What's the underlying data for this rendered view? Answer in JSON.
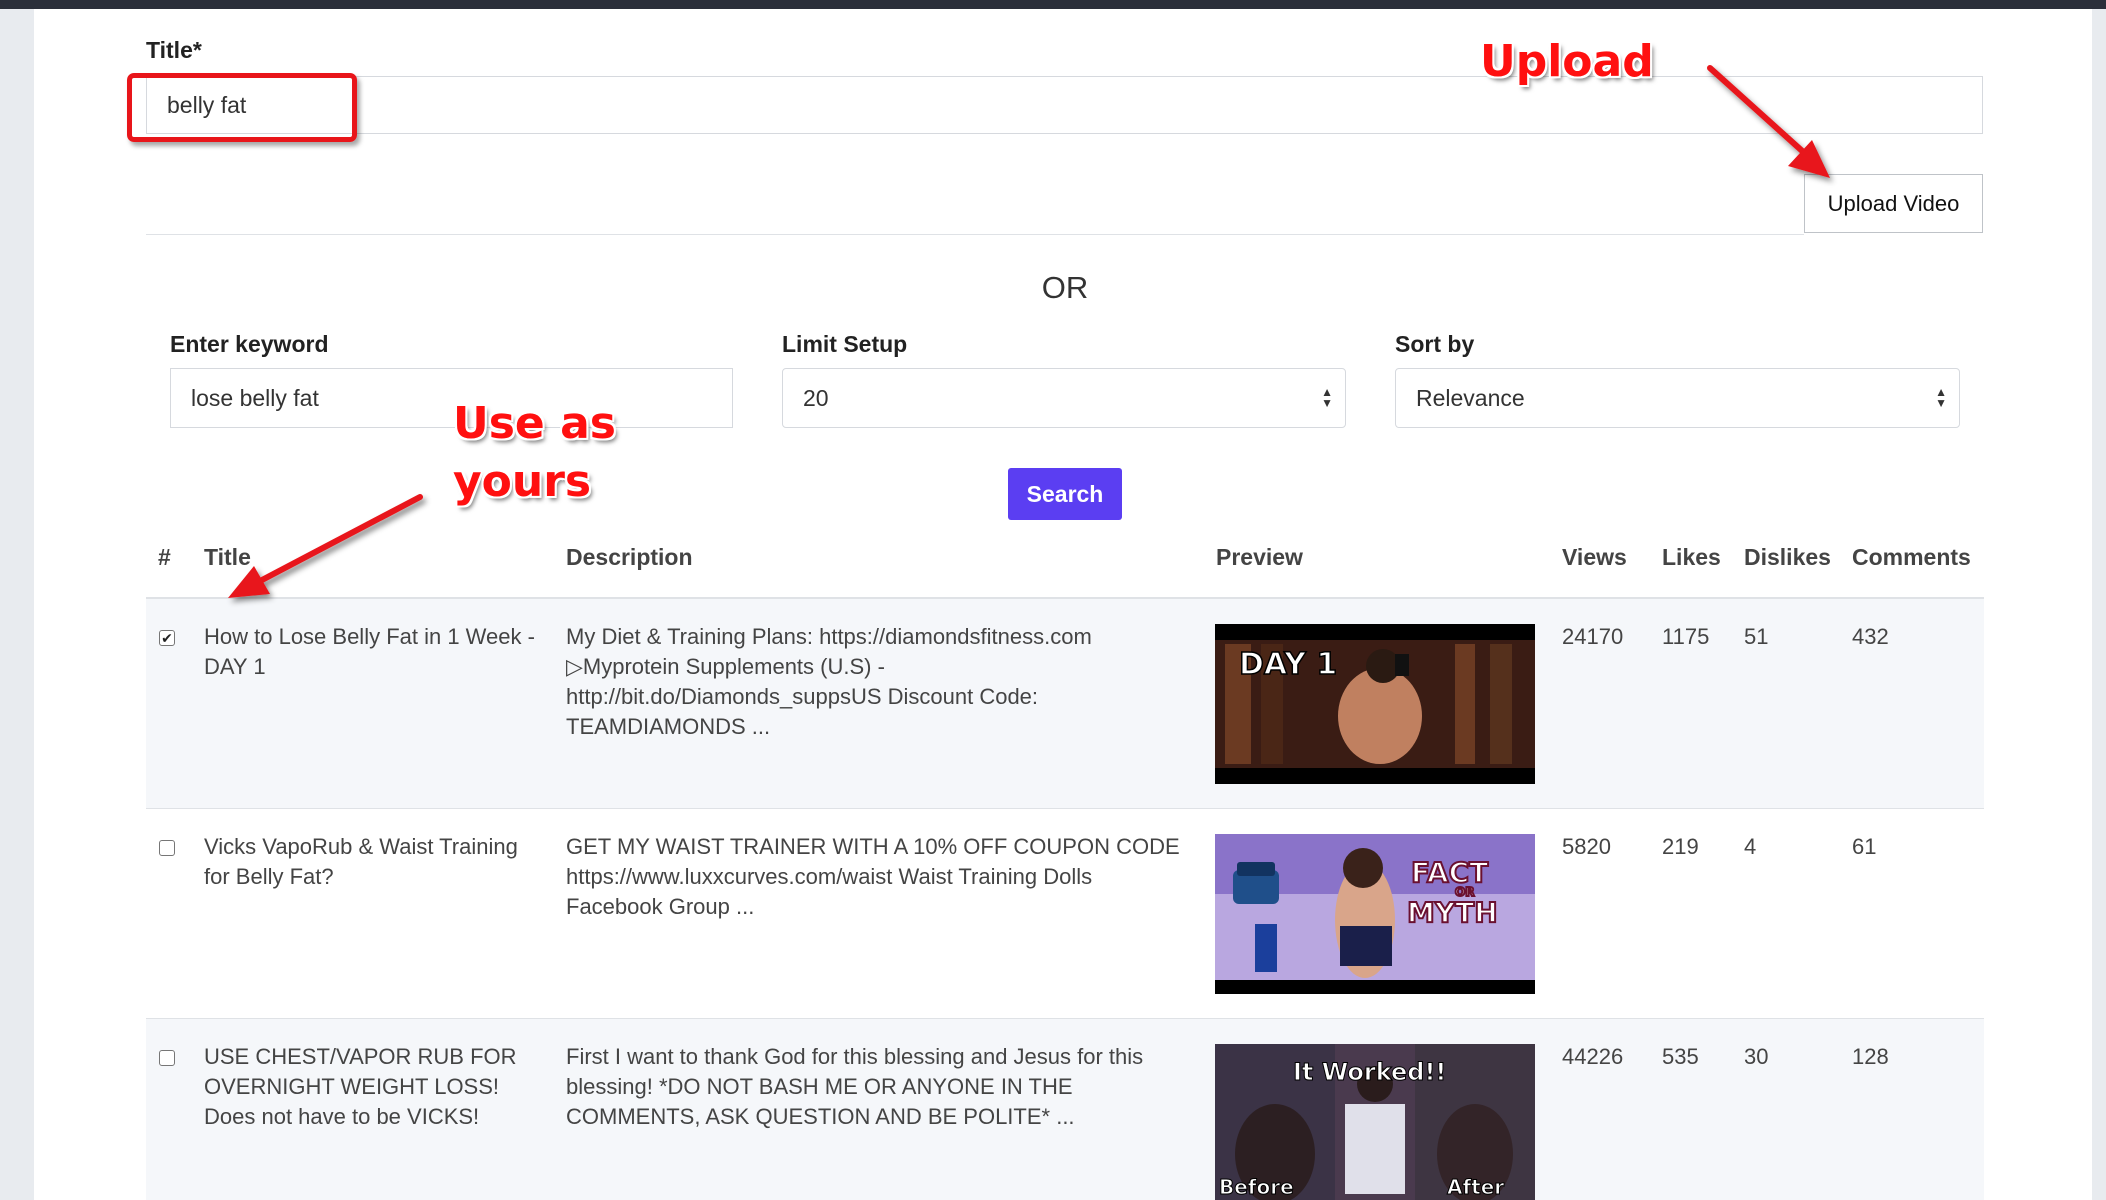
{
  "form": {
    "title_label": "Title*",
    "title_value": "belly fat",
    "upload_button": "Upload Video",
    "or_text": "OR",
    "keyword_label": "Enter keyword",
    "keyword_value": "lose belly fat",
    "limit_label": "Limit Setup",
    "limit_value": "20",
    "sort_label": "Sort by",
    "sort_value": "Relevance",
    "search_button": "Search"
  },
  "table": {
    "headers": [
      "#",
      "Title",
      "Description",
      "Preview",
      "Views",
      "Likes",
      "Dislikes",
      "Comments"
    ],
    "rows": [
      {
        "checked": true,
        "title": "How to Lose Belly Fat in 1 Week - DAY 1",
        "description": "My Diet & Training Plans: https://diamondsfitness.com ▷Myprotein Supplements (U.S) - http://bit.do/Diamonds_suppsUS Discount Code: TEAMDIAMONDS ...",
        "thumb_text": "DAY 1",
        "views": "24170",
        "likes": "1175",
        "dislikes": "51",
        "comments": "432"
      },
      {
        "checked": false,
        "title": "Vicks VapoRub & Waist Training for Belly Fat?",
        "description": "GET MY WAIST TRAINER WITH A 10% OFF COUPON CODE https://www.luxxcurves.com/waist Waist Training Dolls Facebook Group ...",
        "thumb_text_1": "FACT",
        "thumb_text_2": "OR",
        "thumb_text_3": "MYTH",
        "views": "5820",
        "likes": "219",
        "dislikes": "4",
        "comments": "61"
      },
      {
        "checked": false,
        "title": "USE CHEST/VAPOR RUB FOR OVERNIGHT WEIGHT LOSS! Does not have to be VICKS!",
        "description": "First I want to thank God for this blessing and Jesus for this blessing! *DO NOT BASH ME OR ANYONE IN THE COMMENTS, ASK QUESTION AND BE POLITE* ...",
        "thumb_text_1": "It Worked!!",
        "thumb_text_2": "Before",
        "thumb_text_3": "After",
        "views": "44226",
        "likes": "535",
        "dislikes": "30",
        "comments": "128"
      }
    ]
  },
  "annotations": {
    "upload": "Upload",
    "use_line1": "Use as",
    "use_line2": "yours"
  },
  "colors": {
    "accent": "#5b3ef2",
    "annotation_red": "#ff1010"
  }
}
